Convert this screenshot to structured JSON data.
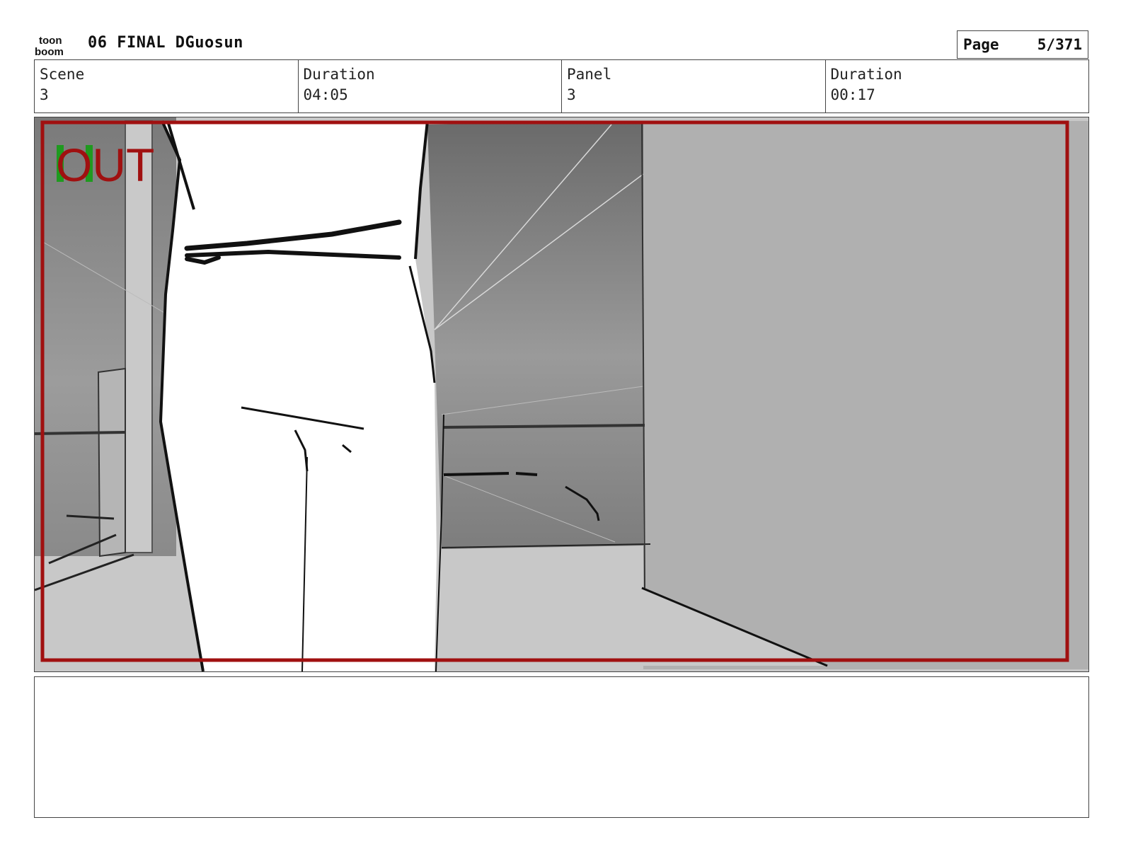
{
  "header": {
    "logo_text_top": "toon",
    "logo_text_bottom": "boom",
    "title": "06 FINAL DGuosun",
    "page_label": "Page",
    "page_value": "5/371"
  },
  "info": [
    {
      "label": "Scene",
      "value": "3"
    },
    {
      "label": "Duration",
      "value": "04:05"
    },
    {
      "label": "Panel",
      "value": "3"
    },
    {
      "label": "Duration",
      "value": "00:17"
    }
  ],
  "panel": {
    "overlay_text": "OUT",
    "frame_color": "#a01010"
  },
  "notes": {
    "text": ""
  }
}
